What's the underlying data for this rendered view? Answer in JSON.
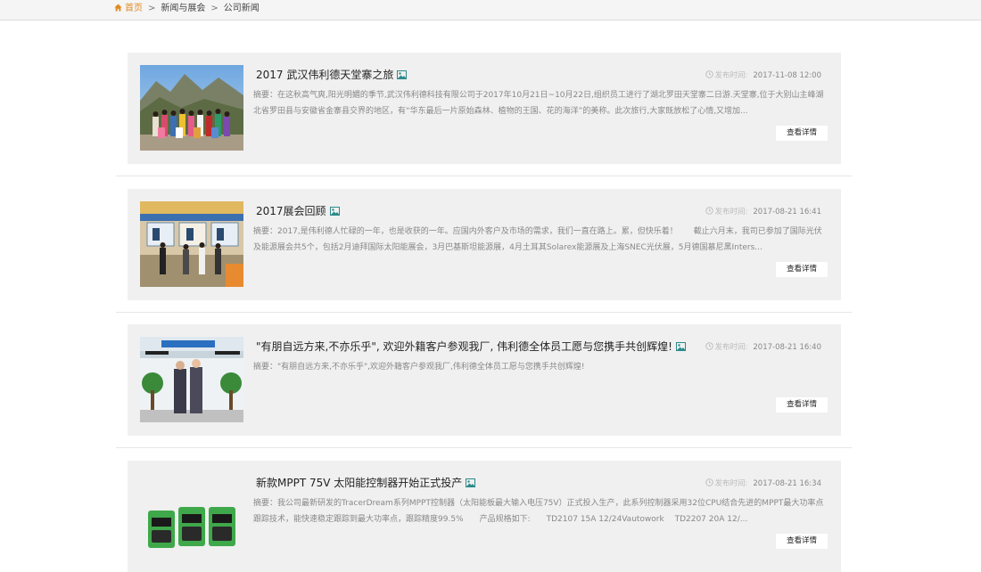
{
  "breadcrumb": {
    "home": "首页",
    "separator": ">",
    "level1": "新闻与展会",
    "level2": "公司新闻"
  },
  "news": [
    {
      "title": "2017 武汉伟利德天堂寨之旅",
      "date_label": "发布时间:",
      "date": "2017-11-08 12:00",
      "summary": "摘要：在这秋高气爽,阳光明媚的季节,武汉伟利德科技有限公司于2017年10月21日~10月22日,组织员工进行了湖北罗田天堂寨二日游.天堂寨,位于大别山主峰湖北省罗田县与安徽省金寨县交界的地区，有“华东最后一片原始森林、植物的王国、花的海洋”的美称。此次旅行,大家既放松了心情,又增加...",
      "button": "查看详情",
      "thumb_icon": "group-photo-mountain"
    },
    {
      "title": "2017展会回顾",
      "date_label": "发布时间:",
      "date": "2017-08-21 16:41",
      "summary": "摘要：2017,是伟利德人忙碌的一年，也是收获的一年。应国内外客户及市场的需求，我们一直在路上。累，但快乐着！　　截止六月末，我司已参加了国际光伏及能源展会共5个，包括2月迪拜国际太阳能展会，3月巴基斯坦能源展，4月土耳其Solarex能源展及上海SNEC光伏展，5月德国慕尼黑Inters...",
      "button": "查看详情",
      "thumb_icon": "exhibition-booth"
    },
    {
      "title": "\"有朋自远方来,不亦乐乎\", 欢迎外籍客户参观我厂, 伟利德全体员工愿与您携手共创辉煌!",
      "date_label": "发布时间:",
      "date": "2017-08-21 16:40",
      "summary": "摘要：\"有朋自远方来,不亦乐乎\",欢迎外籍客户参观我厂,伟利德全体员工愿与您携手共创辉煌!",
      "button": "查看详情",
      "thumb_icon": "customer-visit"
    },
    {
      "title": "新款MPPT 75V 太阳能控制器开始正式投产",
      "date_label": "发布时间:",
      "date": "2017-08-21 16:34",
      "summary": "摘要：我公司最新研发的TracerDream系列MPPT控制器（太阳能板最大输入电压75V）正式投入生产，此系列控制器采用32位CPU结合先进的MPPT最大功率点跟踪技术，能快速稳定跟踪到最大功率点，跟踪精度99.5%　　产品规格如下:　　TD2107 15A 12/24Vautowork　 TD2207 20A 12/...",
      "button": "查看详情",
      "thumb_icon": "mppt-controller-products"
    }
  ],
  "colors": {
    "accent": "#e08a1e",
    "card_bg": "#f0f0f0",
    "image_icon": "#2a8a8a"
  }
}
